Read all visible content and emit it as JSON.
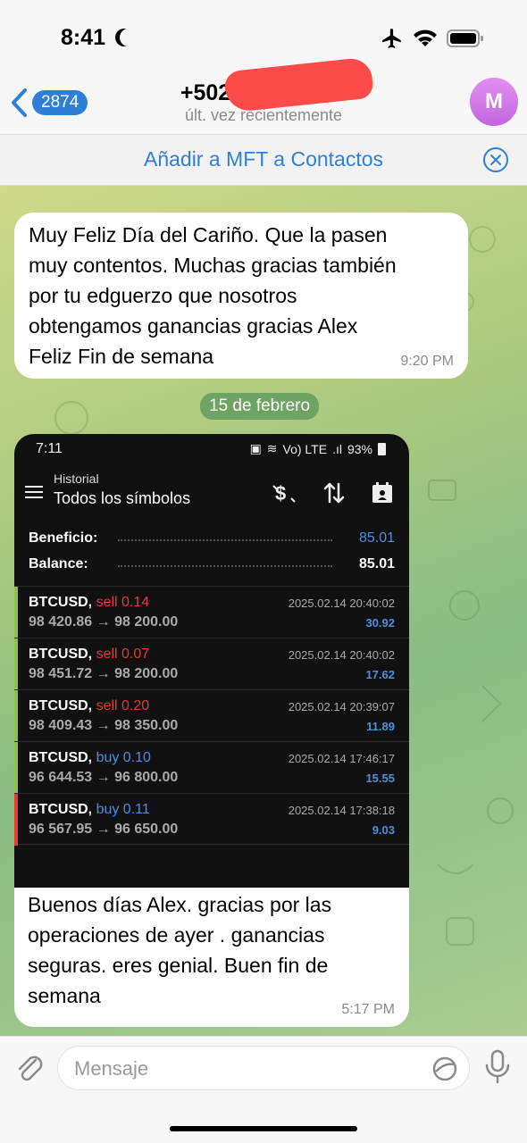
{
  "status_bar": {
    "time": "8:41"
  },
  "header": {
    "back_count": "2874",
    "title": "+502",
    "subtitle": "últ. vez recientemente",
    "avatar_letter": "M"
  },
  "add_contact": {
    "label": "Añadir a MFT a Contactos"
  },
  "messages": [
    {
      "text": "Muy Feliz Día del Cariño.  Que la pasen\nmuy contentos.   Muchas gracias también\npor tu edguerzo  que nosotros\nobtengamos ganancias gracias Alex\nFeliz Fin de semana",
      "time": "9:20 PM"
    },
    {
      "text": "Buenos días Alex.  gracias por las\noperaciones de ayer  . ganancias\nseguras.   eres genial.   Buen fin de\nsemana",
      "time": "5:17 PM"
    }
  ],
  "date_separator": "15 de febrero",
  "screenshot": {
    "time": "7:11",
    "battery": "93%",
    "network": "Vo) LTE",
    "header_small": "Historial",
    "header_main": "Todos los símbolos",
    "summary": [
      {
        "label": "Beneficio:",
        "value": "85.01"
      },
      {
        "label": "Balance:",
        "value": "85.01"
      }
    ],
    "trades": [
      {
        "symbol": "BTCUSD,",
        "side": "sell 0.14",
        "type": "sell",
        "open": "98 420.86",
        "arrow": "→",
        "close": "98 200.00",
        "timestamp": "2025.02.14 20:40:02",
        "profit": "30.92"
      },
      {
        "symbol": "BTCUSD,",
        "side": "sell 0.07",
        "type": "sell",
        "open": "98 451.72",
        "arrow": "→",
        "close": "98 200.00",
        "timestamp": "2025.02.14 20:40:02",
        "profit": "17.62"
      },
      {
        "symbol": "BTCUSD,",
        "side": "sell 0.20",
        "type": "sell",
        "open": "98 409.43",
        "arrow": "→",
        "close": "98 350.00",
        "timestamp": "2025.02.14 20:39:07",
        "profit": "11.89"
      },
      {
        "symbol": "BTCUSD,",
        "side": "buy 0.10",
        "type": "buy",
        "open": "96 644.53",
        "arrow": "→",
        "close": "96 800.00",
        "timestamp": "2025.02.14 17:46:17",
        "profit": "15.55"
      },
      {
        "symbol": "BTCUSD,",
        "side": "buy 0.11",
        "type": "buy",
        "open": "96 567.95",
        "arrow": "→",
        "close": "96 650.00",
        "timestamp": "2025.02.14 17:38:18",
        "profit": "9.03"
      }
    ],
    "colors": {
      "sell": "#e53935",
      "buy": "#4a90e2",
      "accent_green": "#8bc34a",
      "accent_red": "#e53935"
    }
  },
  "input": {
    "placeholder": "Mensaje"
  }
}
